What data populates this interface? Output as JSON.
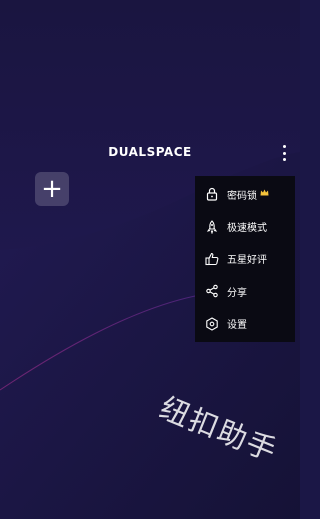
{
  "app": {
    "logo_text": "DUALSPACE"
  },
  "toolbar": {
    "more_icon": "more-vertical-icon",
    "add_icon": "plus-icon",
    "add_symbol": "+"
  },
  "menu": {
    "items": [
      {
        "label": "密码锁",
        "icon": "lock-icon",
        "badge": "crown-icon"
      },
      {
        "label": "极速模式",
        "icon": "rocket-icon"
      },
      {
        "label": "五星好评",
        "icon": "thumbs-up-icon"
      },
      {
        "label": "分享",
        "icon": "share-icon"
      },
      {
        "label": "设置",
        "icon": "settings-icon"
      }
    ]
  },
  "watermark": {
    "text": "纽扣助手"
  },
  "colors": {
    "background": "#1b1746",
    "menu_background": "#0a0a13",
    "crown": "#f5c33b"
  }
}
